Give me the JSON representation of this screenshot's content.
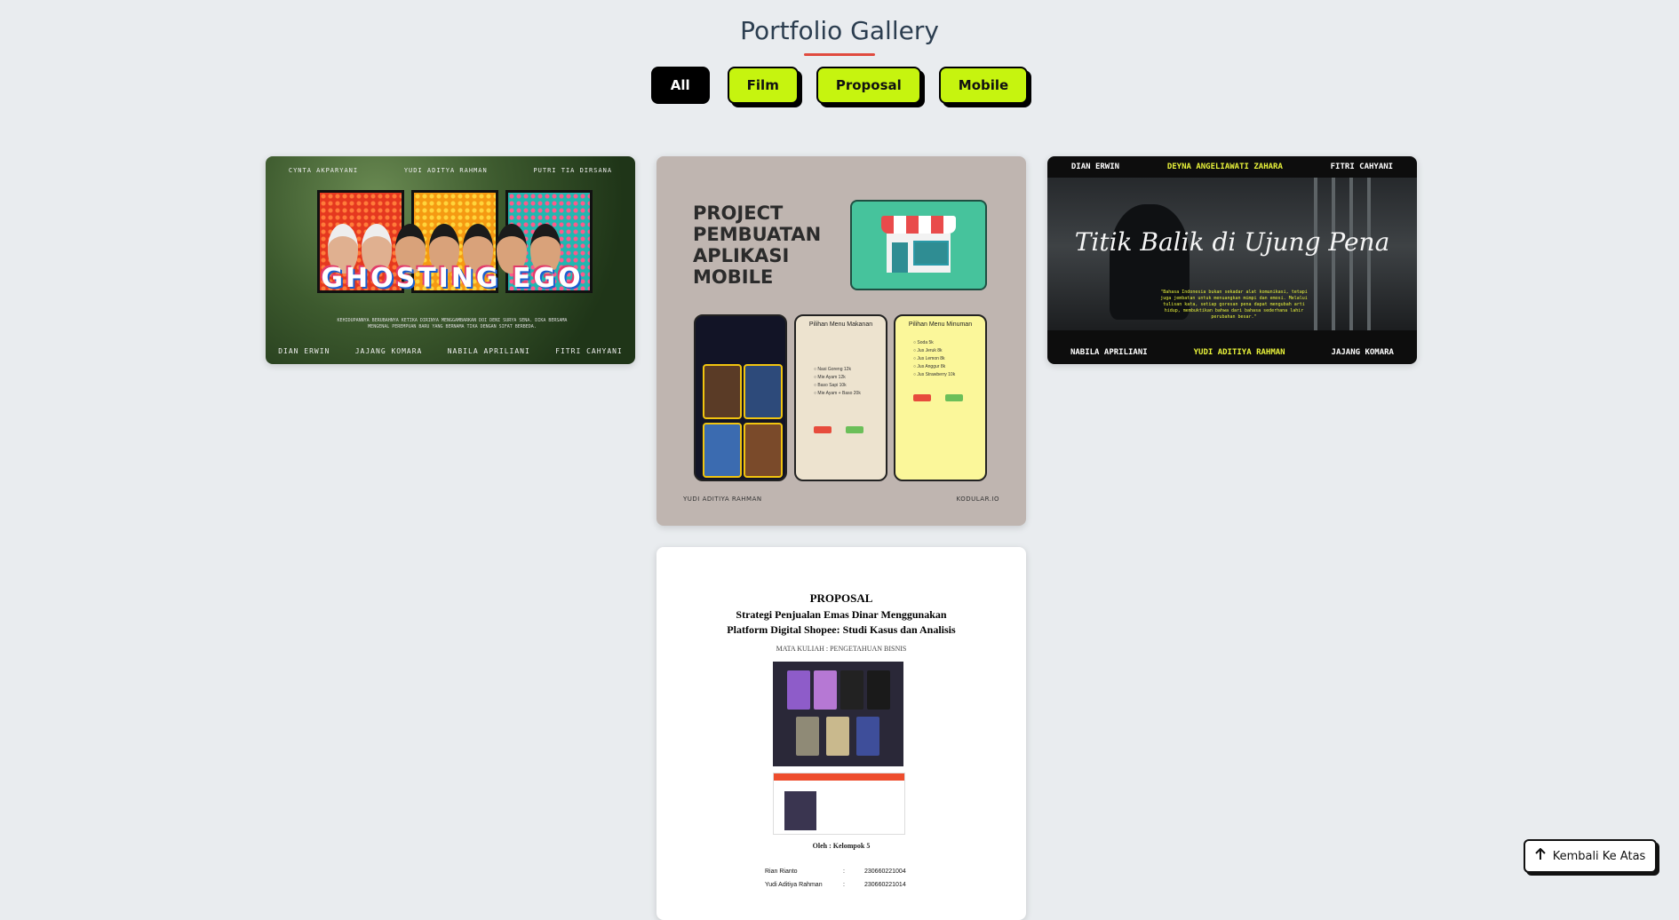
{
  "header": {
    "title": "Portfolio Gallery"
  },
  "filters": [
    {
      "label": "All",
      "active": true
    },
    {
      "label": "Film",
      "active": false
    },
    {
      "label": "Proposal",
      "active": false
    },
    {
      "label": "Mobile",
      "active": false
    }
  ],
  "cards": {
    "film1": {
      "credits_top": [
        "CYNTA AKPARYANI",
        "YUDI ADITYA RAHMAN",
        "PUTRI TIA DIRSANA"
      ],
      "logo": "GHOSTING EGO",
      "synopsis": "KEHIDUPANNYA BERUBAHNYA KETIKA DIRINYA MENGGAMBARKAN DOI DENI SURYA SENA. DIKA BERSAMA MENGENAL PEREMPUAN BARU YANG BERNAMA TIKA DENGAN SIFAT BERBEDA.",
      "credits_bottom": [
        "DIAN ERWIN",
        "JAJANG KOMARA",
        "NABILA APRILIANI",
        "FITRI CAHYANI"
      ]
    },
    "mobile": {
      "title": "PROJECT\nPEMBUATAN\nAPLIKASI\nMOBILE",
      "phone2_title": "Pilihan Menu Makanan",
      "phone2_items": [
        "Nasi Goreng 12k",
        "Mie Ayam 12k",
        "Baso Sapi 10k",
        "Mie Ayam + Baso 20k"
      ],
      "phone3_title": "Pilihan Menu Minuman",
      "phone3_items": [
        "Soda 5k",
        "Jus Jeruk 8k",
        "Jus Lemon 8k",
        "Jus Anggur 8k",
        "Jus Strawberry 10k"
      ],
      "footer_left": "YUDI ADITIYA RAHMAN",
      "footer_right": "KODULAR.IO"
    },
    "film2": {
      "top": [
        "DIAN ERWIN",
        "DEYNA ANGELIAWATI ZAHARA",
        "FITRI CAHYANI"
      ],
      "title": "Titik Balik di Ujung Pena",
      "quote": "\"Bahasa Indonesia bukan sekadar alat komunikasi, tetapi juga jembatan untuk menuangkan mimpi dan emosi. Melalui tulisan kata, setiap goresan pena dapat mengubah arti hidup, membuktikan bahwa dari bahasa sederhana lahir perubahan besar.\"",
      "bottom": [
        "NABILA APRILIANI",
        "YUDI ADITIYA RAHMAN",
        "JAJANG KOMARA"
      ]
    },
    "proposal": {
      "heading": "PROPOSAL",
      "subtitle_line1": "Strategi Penjualan Emas Dinar  Menggunakan",
      "subtitle_line2": "Platform Digital Shopee: Studi Kasus dan Analisis",
      "course": "MATA KULIAH : PENGETAHUAN BISNIS",
      "by": "Oleh : Kelompok 5",
      "members": [
        {
          "name": "Rian Rianto",
          "nim": "230660221004"
        },
        {
          "name": "Yudi Aditiya Rahman",
          "nim": "230660221014"
        }
      ]
    }
  },
  "back_to_top": {
    "label": "Kembali Ke Atas",
    "icon": "arrow-up-icon"
  },
  "colors": {
    "accent": "#c6f40f",
    "underline": "#e04b3f",
    "background": "#e9ecef"
  }
}
